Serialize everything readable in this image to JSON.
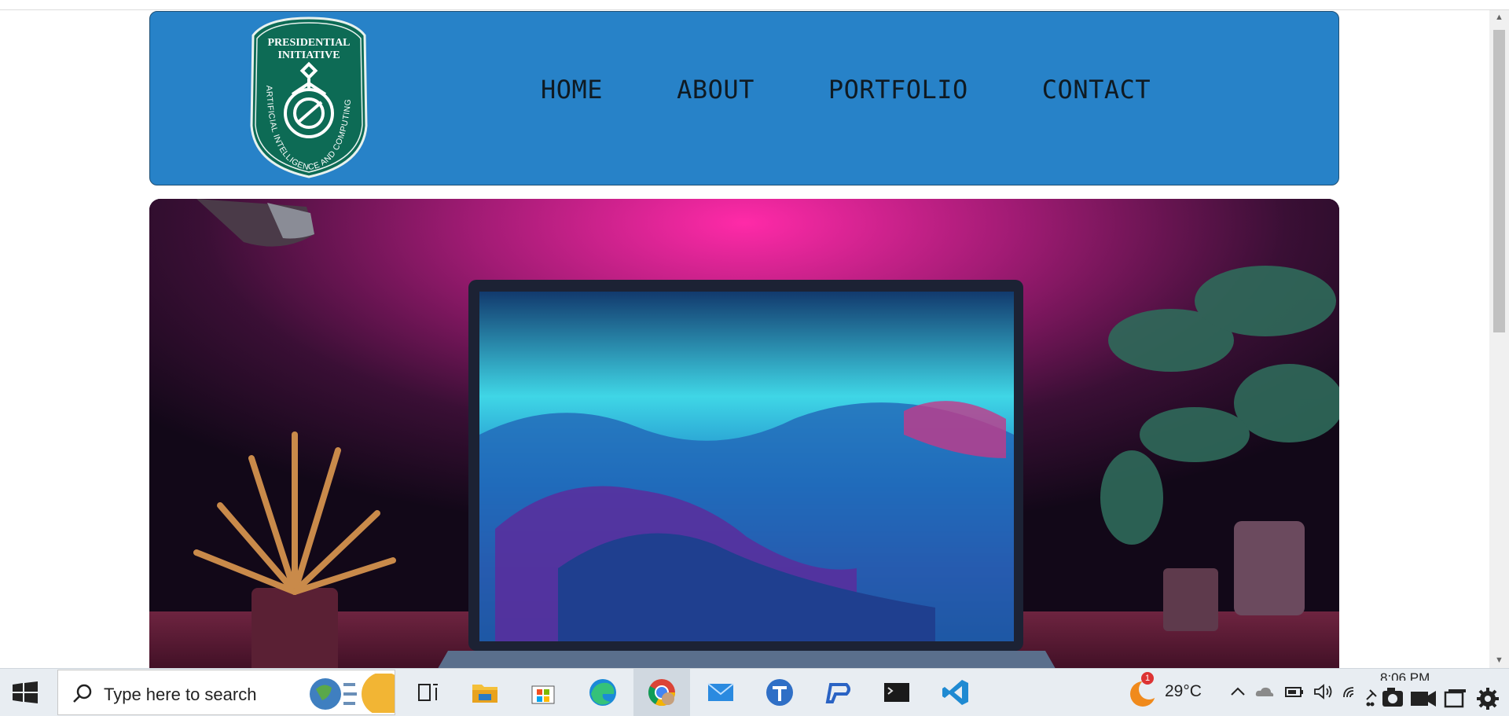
{
  "logo": {
    "line1": "PRESIDENTIAL",
    "line2": "INITIATIVE",
    "arc_text": "ARTIFICIAL INTELLIGENCE AND COMPUTING"
  },
  "nav": {
    "items": [
      {
        "label": "HOME"
      },
      {
        "label": "ABOUT"
      },
      {
        "label": "PORTFOLIO"
      },
      {
        "label": "CONTACT"
      }
    ]
  },
  "colors": {
    "header_bg": "#2782c8",
    "logo_green": "#0d6b55",
    "taskbar_bg": "#e8edf2"
  },
  "taskbar": {
    "search_placeholder": "Type here to search",
    "icons": [
      "windows-start-icon",
      "search-icon",
      "task-view-icon",
      "file-explorer-icon",
      "microsoft-store-icon",
      "edge-icon",
      "chrome-icon",
      "mail-icon",
      "app-t-icon",
      "app-p-icon",
      "terminal-icon",
      "vscode-icon"
    ],
    "weather_temp": "29°C",
    "weather_badge": "1",
    "clock_time": "8:06 PM"
  }
}
